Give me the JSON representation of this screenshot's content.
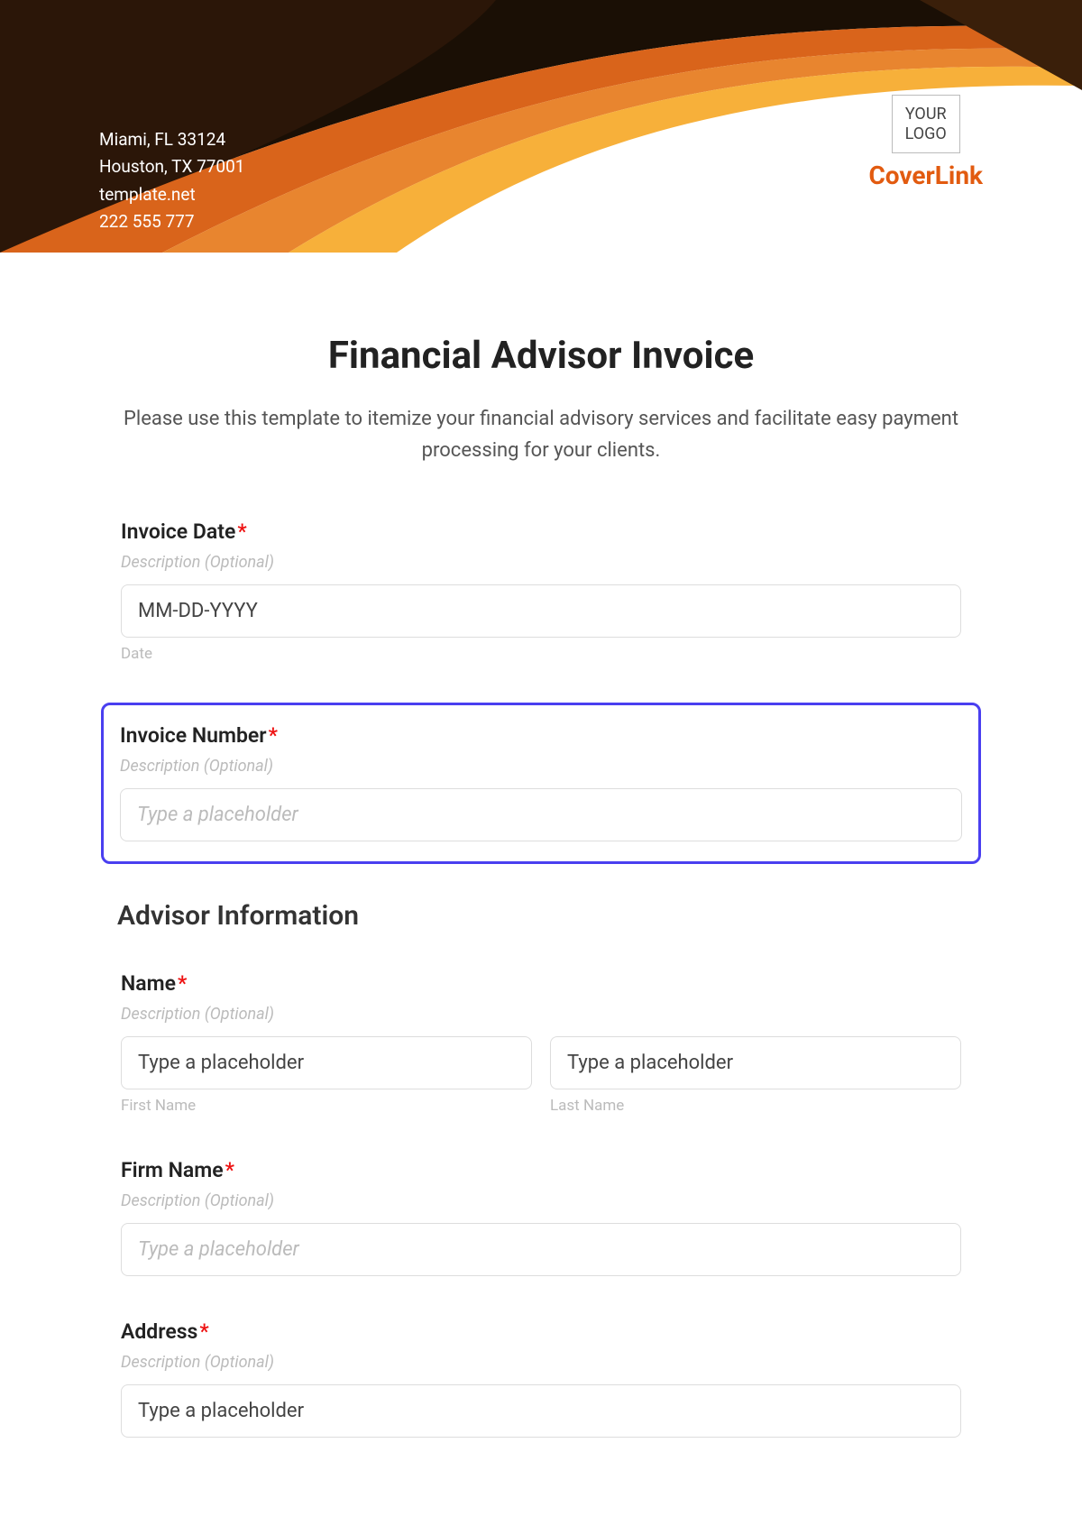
{
  "header": {
    "contact_line1": "Miami, FL 33124",
    "contact_line2": "Houston, TX 77001",
    "contact_line3": "template.net",
    "contact_line4": "222 555 777",
    "logo_text_line1": "YOUR",
    "logo_text_line2": "LOGO",
    "brand": "CoverLink"
  },
  "form": {
    "title": "Financial Advisor Invoice",
    "description": "Please use this template to itemize your financial advisory services and facilitate easy payment processing for your clients."
  },
  "fields": {
    "invoice_date": {
      "label": "Invoice Date",
      "subdesc": "Description (Optional)",
      "placeholder": "MM-DD-YYYY",
      "caption": "Date"
    },
    "invoice_number": {
      "label": "Invoice Number",
      "subdesc": "Description (Optional)",
      "placeholder": "Type a placeholder"
    },
    "section_advisor": "Advisor Information",
    "name": {
      "label": "Name",
      "subdesc": "Description (Optional)",
      "first_placeholder": "Type a placeholder",
      "last_placeholder": "Type a placeholder",
      "first_caption": "First Name",
      "last_caption": "Last Name"
    },
    "firm": {
      "label": "Firm Name",
      "subdesc": "Description (Optional)",
      "placeholder": "Type a placeholder"
    },
    "address": {
      "label": "Address",
      "subdesc": "Description (Optional)",
      "placeholder": "Type a placeholder"
    }
  }
}
